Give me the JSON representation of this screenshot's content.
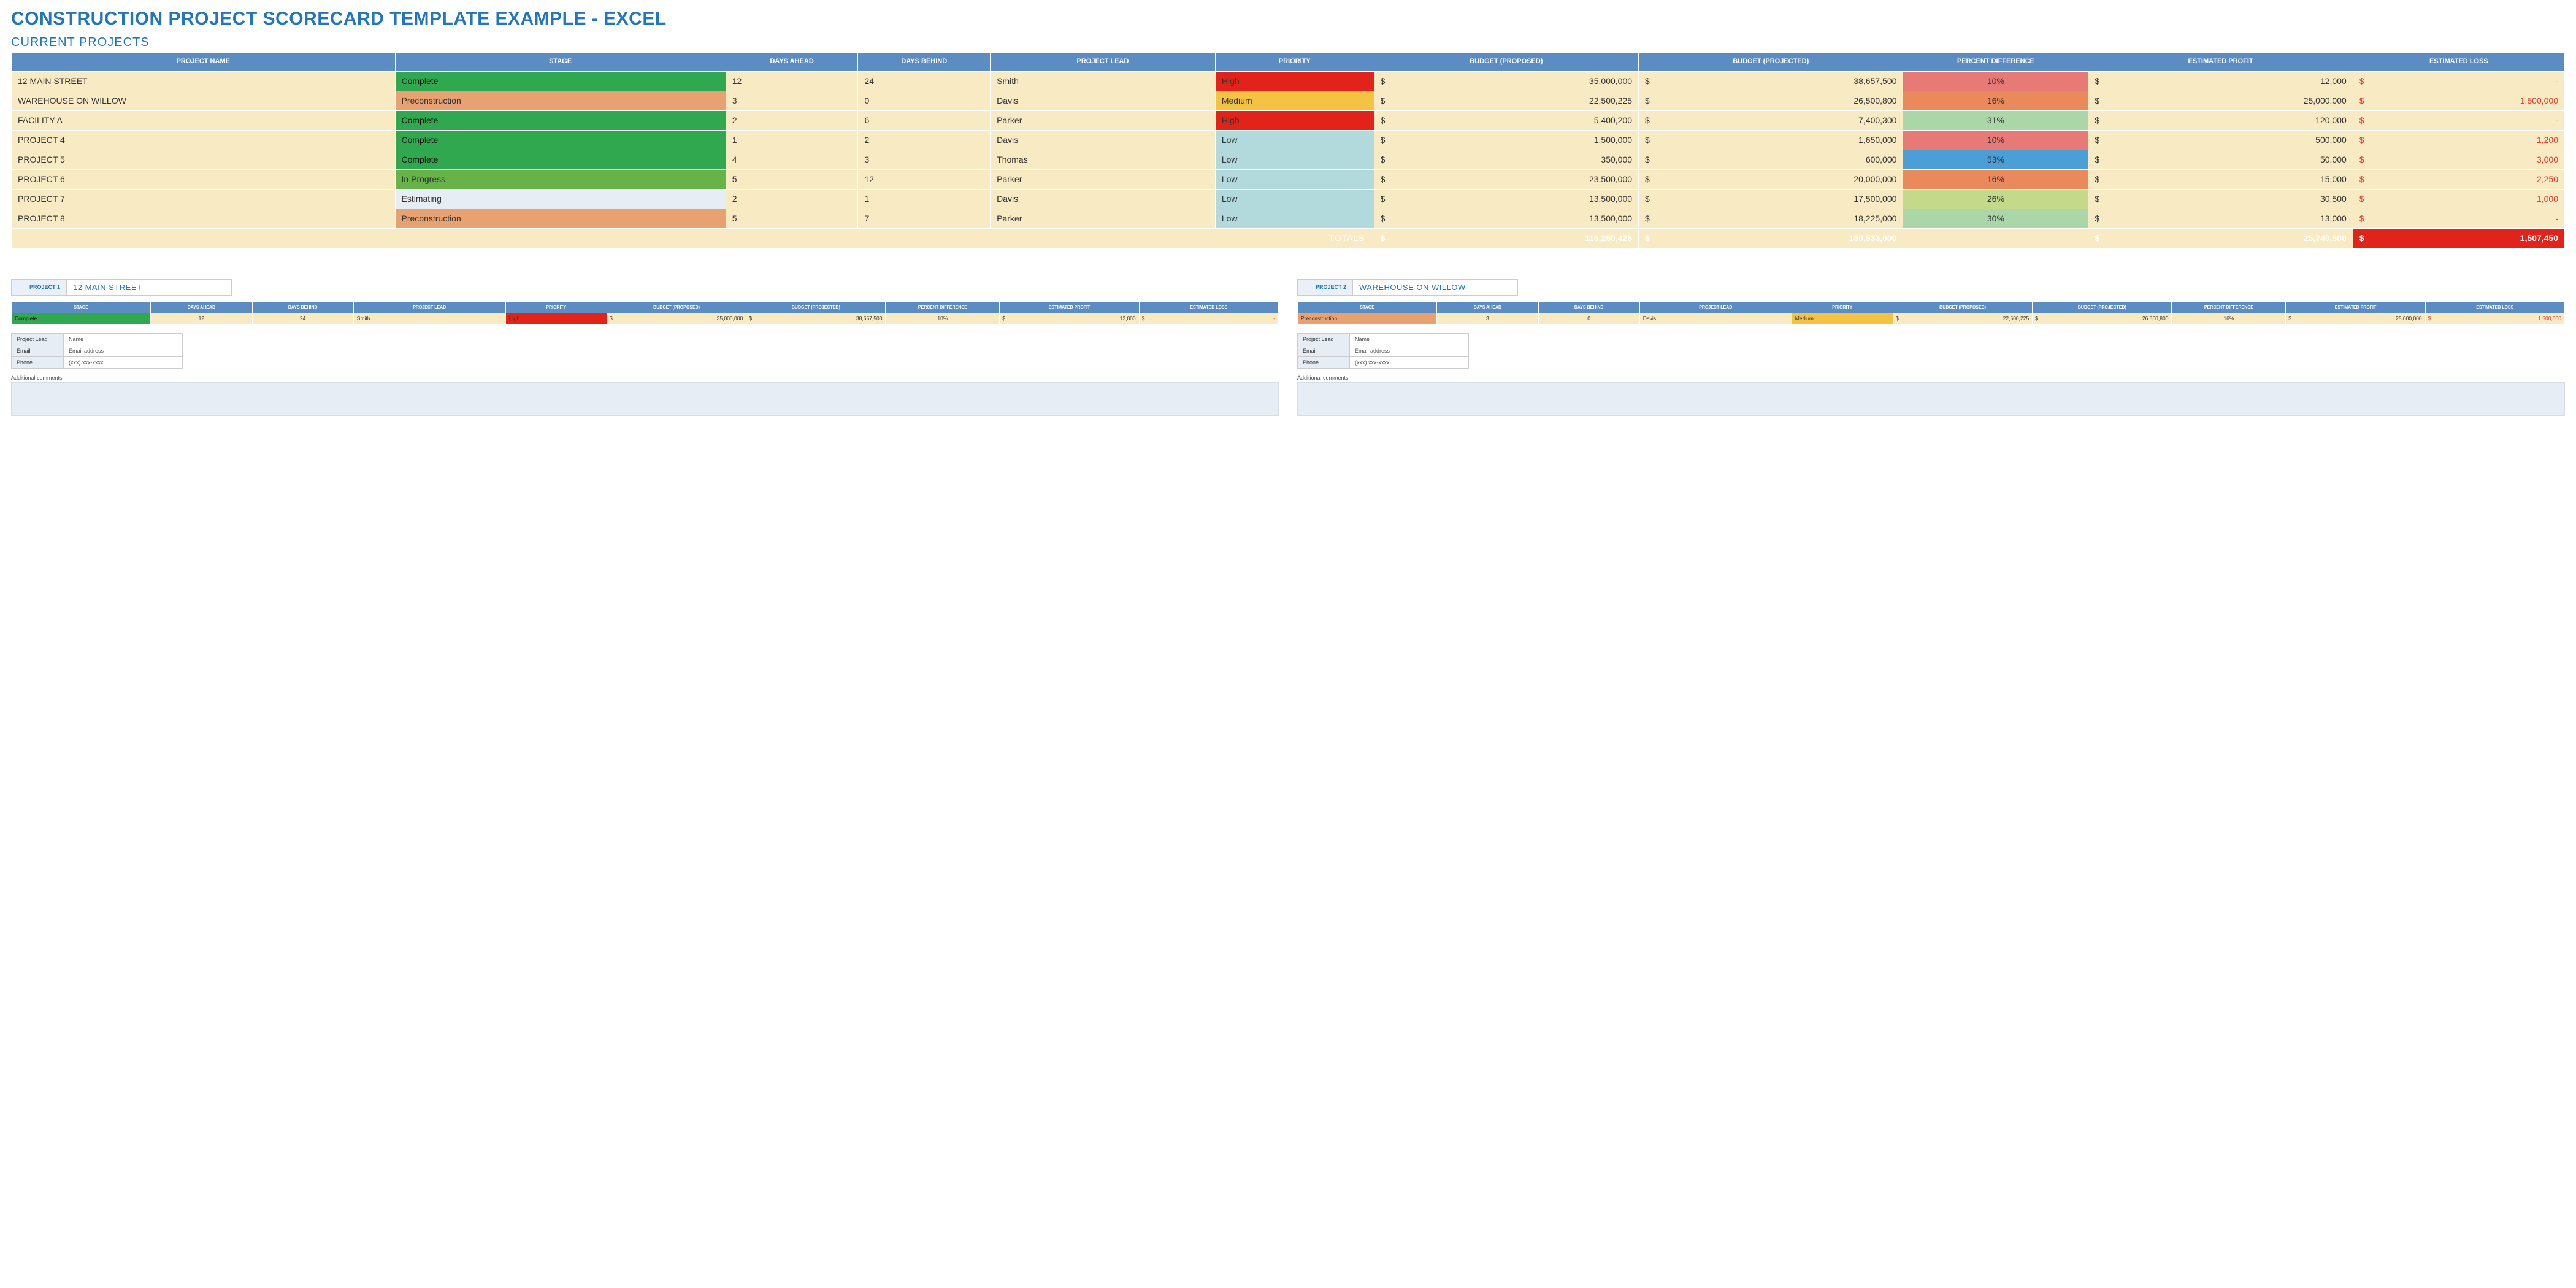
{
  "title": "CONSTRUCTION PROJECT SCORECARD TEMPLATE EXAMPLE - EXCEL",
  "section": "CURRENT PROJECTS",
  "headers": {
    "name": "PROJECT NAME",
    "stage": "STAGE",
    "days_ahead": "DAYS AHEAD",
    "days_behind": "DAYS BEHIND",
    "lead": "PROJECT LEAD",
    "priority": "PRIORITY",
    "budget_prop": "BUDGET (PROPOSED)",
    "budget_proj": "BUDGET (PROJECTED)",
    "pct": "PERCENT DIFFERENCE",
    "profit": "ESTIMATED PROFIT",
    "loss": "ESTIMATED LOSS"
  },
  "rows": [
    {
      "name": "12 MAIN STREET",
      "stage": "Complete",
      "stage_cls": "stage-Complete",
      "days_ahead": "12",
      "days_behind": "24",
      "lead": "Smith",
      "priority": "High",
      "pri_cls": "pri-High",
      "budget_prop": "35,000,000",
      "budget_proj": "38,657,500",
      "pct": "10%",
      "pct_cls": "pct-a",
      "profit": "12,000",
      "loss": "-"
    },
    {
      "name": "WAREHOUSE ON WILLOW",
      "stage": "Preconstruction",
      "stage_cls": "stage-Preconstruction",
      "days_ahead": "3",
      "days_behind": "0",
      "lead": "Davis",
      "priority": "Medium",
      "pri_cls": "pri-Medium",
      "budget_prop": "22,500,225",
      "budget_proj": "26,500,800",
      "pct": "16%",
      "pct_cls": "pct-b",
      "profit": "25,000,000",
      "loss": "1,500,000"
    },
    {
      "name": "FACILITY A",
      "stage": "Complete",
      "stage_cls": "stage-Complete",
      "days_ahead": "2",
      "days_behind": "6",
      "lead": "Parker",
      "priority": "High",
      "pri_cls": "pri-High",
      "budget_prop": "5,400,200",
      "budget_proj": "7,400,300",
      "pct": "31%",
      "pct_cls": "pct-c",
      "profit": "120,000",
      "loss": "-"
    },
    {
      "name": "PROJECT 4",
      "stage": "Complete",
      "stage_cls": "stage-Complete",
      "days_ahead": "1",
      "days_behind": "2",
      "lead": "Davis",
      "priority": "Low",
      "pri_cls": "pri-Low",
      "budget_prop": "1,500,000",
      "budget_proj": "1,650,000",
      "pct": "10%",
      "pct_cls": "pct-a",
      "profit": "500,000",
      "loss": "1,200"
    },
    {
      "name": "PROJECT 5",
      "stage": "Complete",
      "stage_cls": "stage-Complete",
      "days_ahead": "4",
      "days_behind": "3",
      "lead": "Thomas",
      "priority": "Low",
      "pri_cls": "pri-Low",
      "budget_prop": "350,000",
      "budget_proj": "600,000",
      "pct": "53%",
      "pct_cls": "pct-d",
      "profit": "50,000",
      "loss": "3,000"
    },
    {
      "name": "PROJECT 6",
      "stage": "In Progress",
      "stage_cls": "stage-InProgress",
      "days_ahead": "5",
      "days_behind": "12",
      "lead": "Parker",
      "priority": "Low",
      "pri_cls": "pri-Low",
      "budget_prop": "23,500,000",
      "budget_proj": "20,000,000",
      "pct": "16%",
      "pct_cls": "pct-b",
      "profit": "15,000",
      "loss": "2,250"
    },
    {
      "name": "PROJECT 7",
      "stage": "Estimating",
      "stage_cls": "stage-Estimating",
      "days_ahead": "2",
      "days_behind": "1",
      "lead": "Davis",
      "priority": "Low",
      "pri_cls": "pri-Low",
      "budget_prop": "13,500,000",
      "budget_proj": "17,500,000",
      "pct": "26%",
      "pct_cls": "pct-e",
      "profit": "30,500",
      "loss": "1,000"
    },
    {
      "name": "PROJECT 8",
      "stage": "Preconstruction",
      "stage_cls": "stage-Preconstruction",
      "days_ahead": "5",
      "days_behind": "7",
      "lead": "Parker",
      "priority": "Low",
      "pri_cls": "pri-Low",
      "budget_prop": "13,500,000",
      "budget_proj": "18,225,000",
      "pct": "30%",
      "pct_cls": "pct-c",
      "profit": "13,000",
      "loss": "-"
    }
  ],
  "totals": {
    "label": "TOTALS",
    "budget_prop": "115,250,425",
    "budget_proj": "130,533,600",
    "profit": "25,740,500",
    "loss": "1,507,450"
  },
  "details": [
    {
      "label": "PROJECT 1",
      "name": "12 MAIN STREET",
      "row_index": 0
    },
    {
      "label": "PROJECT 2",
      "name": "WAREHOUSE ON WILLOW",
      "row_index": 1
    }
  ],
  "contact": {
    "lead_k": "Project Lead",
    "lead_v": "Name",
    "email_k": "Email",
    "email_v": "Email address",
    "phone_k": "Phone",
    "phone_v": "(xxx) xxx-xxxx"
  },
  "comments_label": "Additional comments"
}
